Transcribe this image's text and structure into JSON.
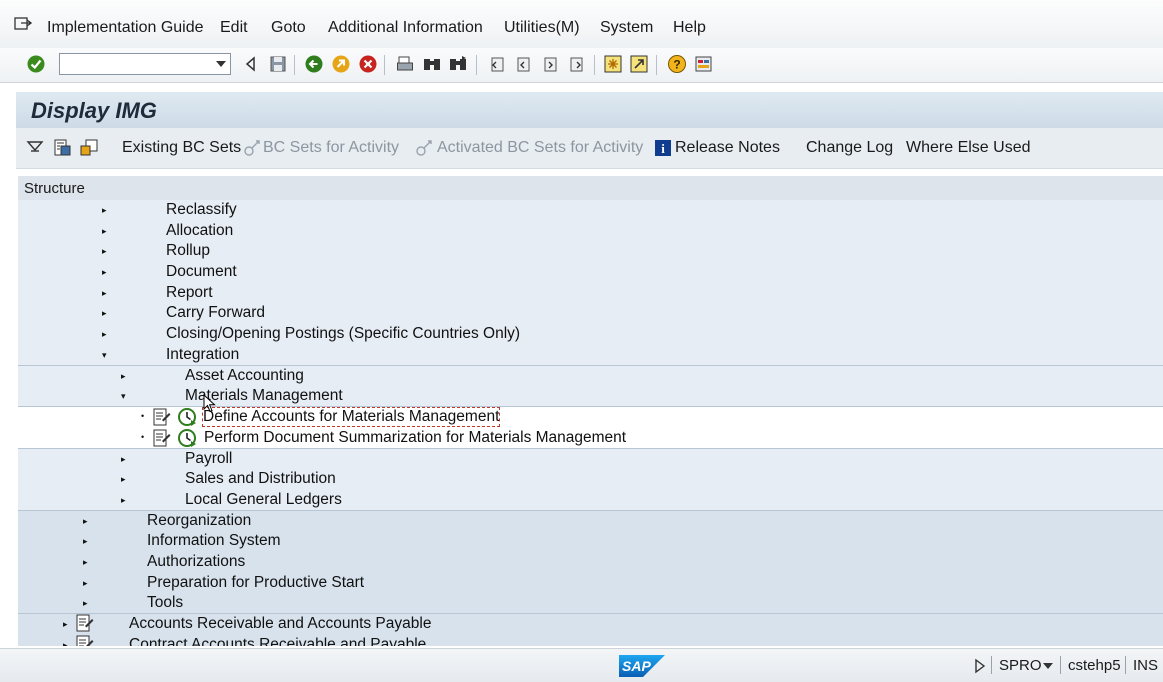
{
  "menubar": {
    "items": [
      {
        "label": "Implementation Guide"
      },
      {
        "label": "Edit"
      },
      {
        "label": "Goto"
      },
      {
        "label": "Additional Information"
      },
      {
        "label": "Utilities(M)"
      },
      {
        "label": "System"
      },
      {
        "label": "Help"
      }
    ]
  },
  "toolbar": {
    "command_value": "",
    "icons": [
      "enter-icon",
      "back-icon",
      "save-icon",
      "back-green-icon",
      "exit-icon",
      "cancel-icon",
      "print-icon",
      "find-icon",
      "find-next-icon",
      "first-page-icon",
      "previous-page-icon",
      "next-page-icon",
      "last-page-icon",
      "create-session-icon",
      "shortcut-icon",
      "help-icon",
      "customize-layout-icon"
    ]
  },
  "title": "Display IMG",
  "app_toolbar": {
    "existing_bc_sets": "Existing BC Sets",
    "bc_sets_for_activity": "BC Sets for Activity",
    "activated_bc_sets": "Activated BC Sets for Activity",
    "release_notes": "Release Notes",
    "change_log": "Change Log",
    "where_else_used": "Where Else Used"
  },
  "tree": {
    "header": "Structure",
    "rows": [
      {
        "label": "Reclassify"
      },
      {
        "label": "Allocation"
      },
      {
        "label": "Rollup"
      },
      {
        "label": "Document"
      },
      {
        "label": "Report"
      },
      {
        "label": "Carry Forward"
      },
      {
        "label": "Closing/Opening Postings (Specific Countries Only)"
      },
      {
        "label": "Integration"
      },
      {
        "label": "Asset Accounting"
      },
      {
        "label": "Materials Management"
      },
      {
        "label": "Define Accounts for Materials Management"
      },
      {
        "label": "Perform Document Summarization for Materials Management"
      },
      {
        "label": "Payroll"
      },
      {
        "label": "Sales and Distribution"
      },
      {
        "label": "Local General Ledgers"
      },
      {
        "label": "Reorganization"
      },
      {
        "label": "Information System"
      },
      {
        "label": "Authorizations"
      },
      {
        "label": "Preparation for Productive Start"
      },
      {
        "label": "Tools"
      },
      {
        "label": "Accounts Receivable and Accounts Payable"
      },
      {
        "label": "Contract Accounts Receivable and Payable"
      }
    ]
  },
  "statusbar": {
    "logo": "SAP",
    "transaction": "SPRO",
    "server": "cstehp5",
    "mode": "INS"
  },
  "colors": {
    "accent_green": "#3a8a1e",
    "title_band": "#cddbe7",
    "tree_band": "#e6edf4",
    "sap_blue": "#0a6ed1"
  }
}
